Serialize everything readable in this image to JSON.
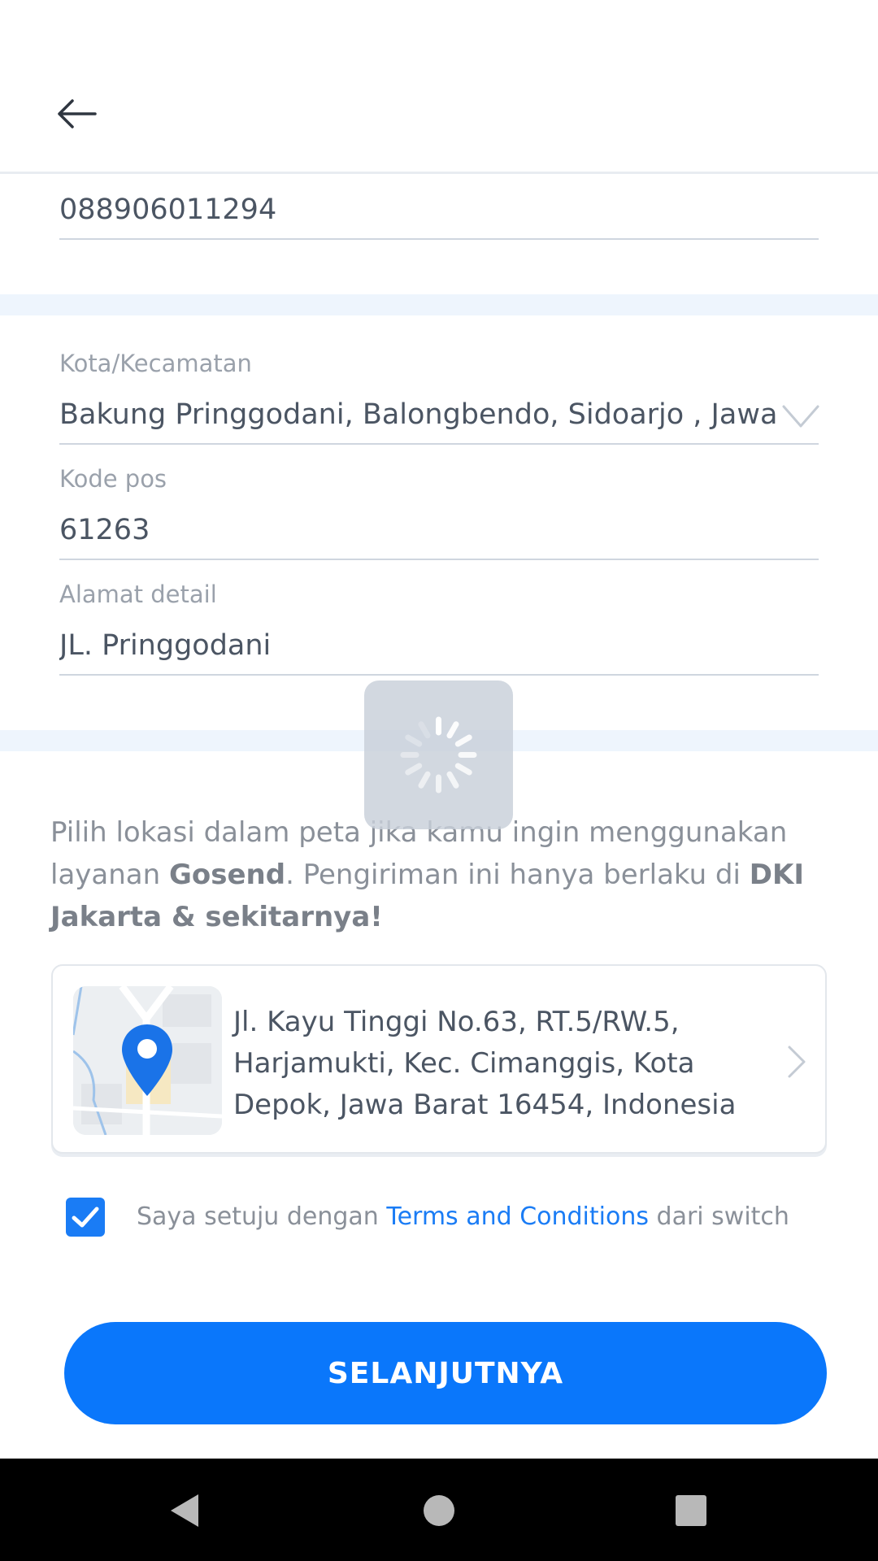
{
  "phone": {
    "value": "088906011294"
  },
  "city": {
    "label": "Kota/Kecamatan",
    "value": "Bakung Pringgodani, Balongbendo, Sidoarjo , Jawa Timur"
  },
  "postal": {
    "label": "Kode pos",
    "value": "61263"
  },
  "address_detail": {
    "label": "Alamat detail",
    "value": "JL. Pringgodani"
  },
  "gosend_info": {
    "part1": "Pilih lokasi dalam peta jika kamu ingin menggunakan layanan ",
    "bold1": "Gosend",
    "part2": ". Pengiriman ini hanya berlaku di ",
    "bold2": "DKI Jakarta & sekitarnya!"
  },
  "location_card": {
    "address": "Jl. Kayu Tinggi No.63, RT.5/RW.5, Harjamukti, Kec. Cimanggis, Kota Depok, Jawa Barat 16454, Indonesia",
    "pin_color": "#1a73e8"
  },
  "terms": {
    "checked": true,
    "prefix": "Saya setuju dengan ",
    "link": "Terms and Conditions",
    "suffix": " dari switch"
  },
  "next_button": {
    "label": "SELANJUTNYA"
  },
  "colors": {
    "primary": "#0a77fb",
    "divider": "#eef5fd"
  },
  "icons": {
    "back": "arrow-left-icon",
    "dropdown": "chevron-down-icon",
    "card": "chevron-right-icon",
    "check": "check-icon",
    "spinner": "loading-spinner-icon",
    "nav": [
      "nav-back-icon",
      "nav-home-icon",
      "nav-recents-icon"
    ]
  }
}
